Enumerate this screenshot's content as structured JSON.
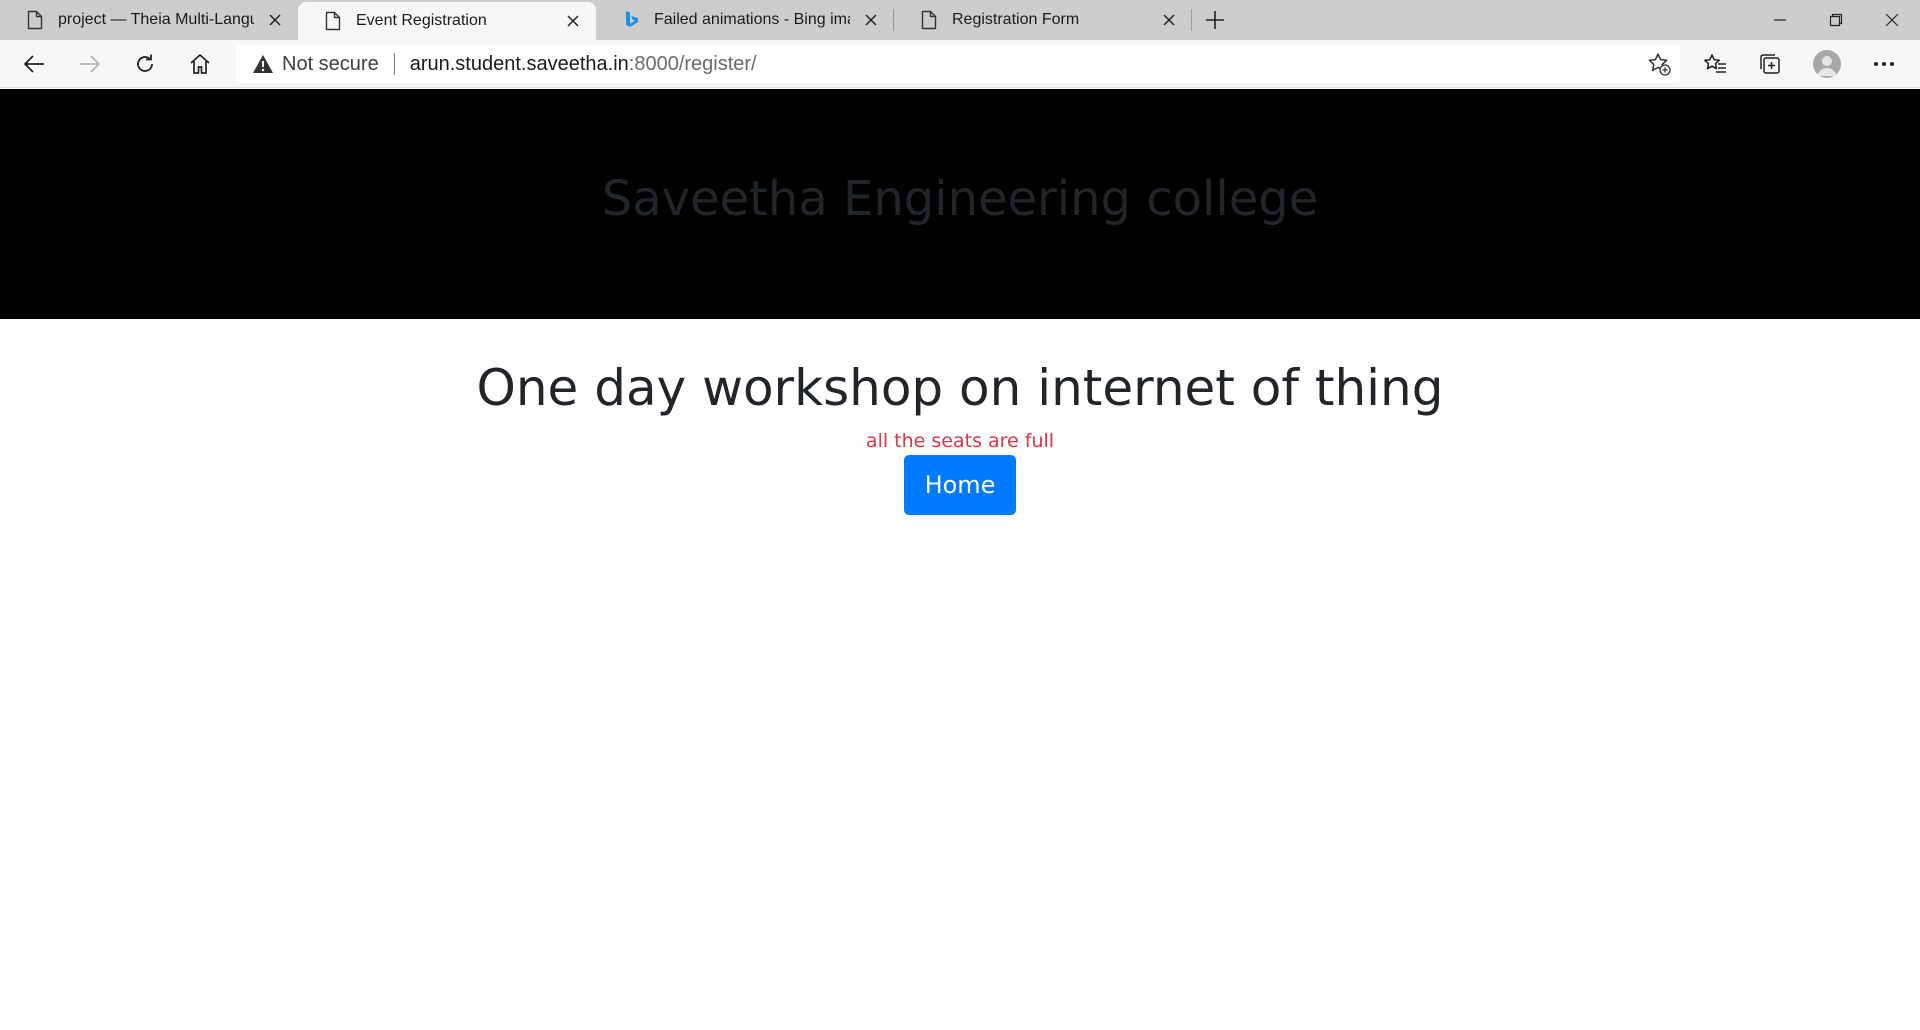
{
  "browser": {
    "tabs": [
      {
        "title": "project — Theia Multi-Language",
        "active": false,
        "icon": "page-icon"
      },
      {
        "title": "Event Registration",
        "active": true,
        "icon": "page-icon"
      },
      {
        "title": "Failed animations - Bing images",
        "active": false,
        "icon": "bing-icon"
      },
      {
        "title": "Registration Form",
        "active": false,
        "icon": "page-icon"
      }
    ],
    "address": {
      "security_label": "Not secure",
      "host": "arun.student.saveetha.in",
      "rest": ":8000/register/"
    },
    "accent_color": "#0078d4"
  },
  "page": {
    "header_title": "Saveetha Engineering college",
    "event_title": "One day workshop on internet of thing",
    "status_message": "all the seats are full",
    "home_button_label": "Home",
    "colors": {
      "header_bg": "#000000",
      "header_text": "#212529",
      "alert_text": "#dc3545",
      "button_bg": "#007bff",
      "button_text": "#ffffff"
    }
  }
}
